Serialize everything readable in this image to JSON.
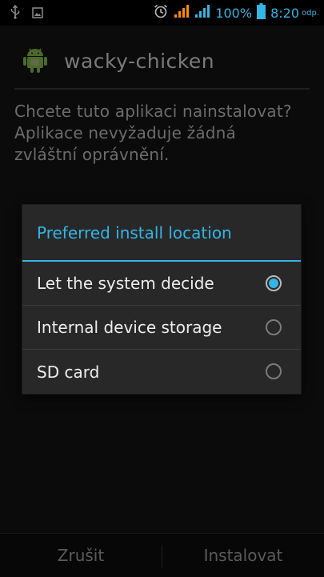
{
  "status_bar": {
    "battery": "100%",
    "time": "8:20",
    "time_suffix": "odp."
  },
  "app": {
    "name": "wacky-chicken",
    "prompt_lines": [
      "Chcete tuto aplikaci nainstalovat?",
      "Aplikace nevyžaduje žádná",
      "zvláštní oprávnění."
    ]
  },
  "dialog": {
    "title": "Preferred install location",
    "options": [
      {
        "label": "Let the system decide",
        "checked": true
      },
      {
        "label": "Internal device storage",
        "checked": false
      },
      {
        "label": "SD card",
        "checked": false
      }
    ]
  },
  "buttons": {
    "cancel": "Zrušit",
    "install": "Instalovat"
  },
  "colors": {
    "accent": "#33b5e5",
    "status_orange": "#ff8a00",
    "signal_blue": "#33b5e5"
  }
}
